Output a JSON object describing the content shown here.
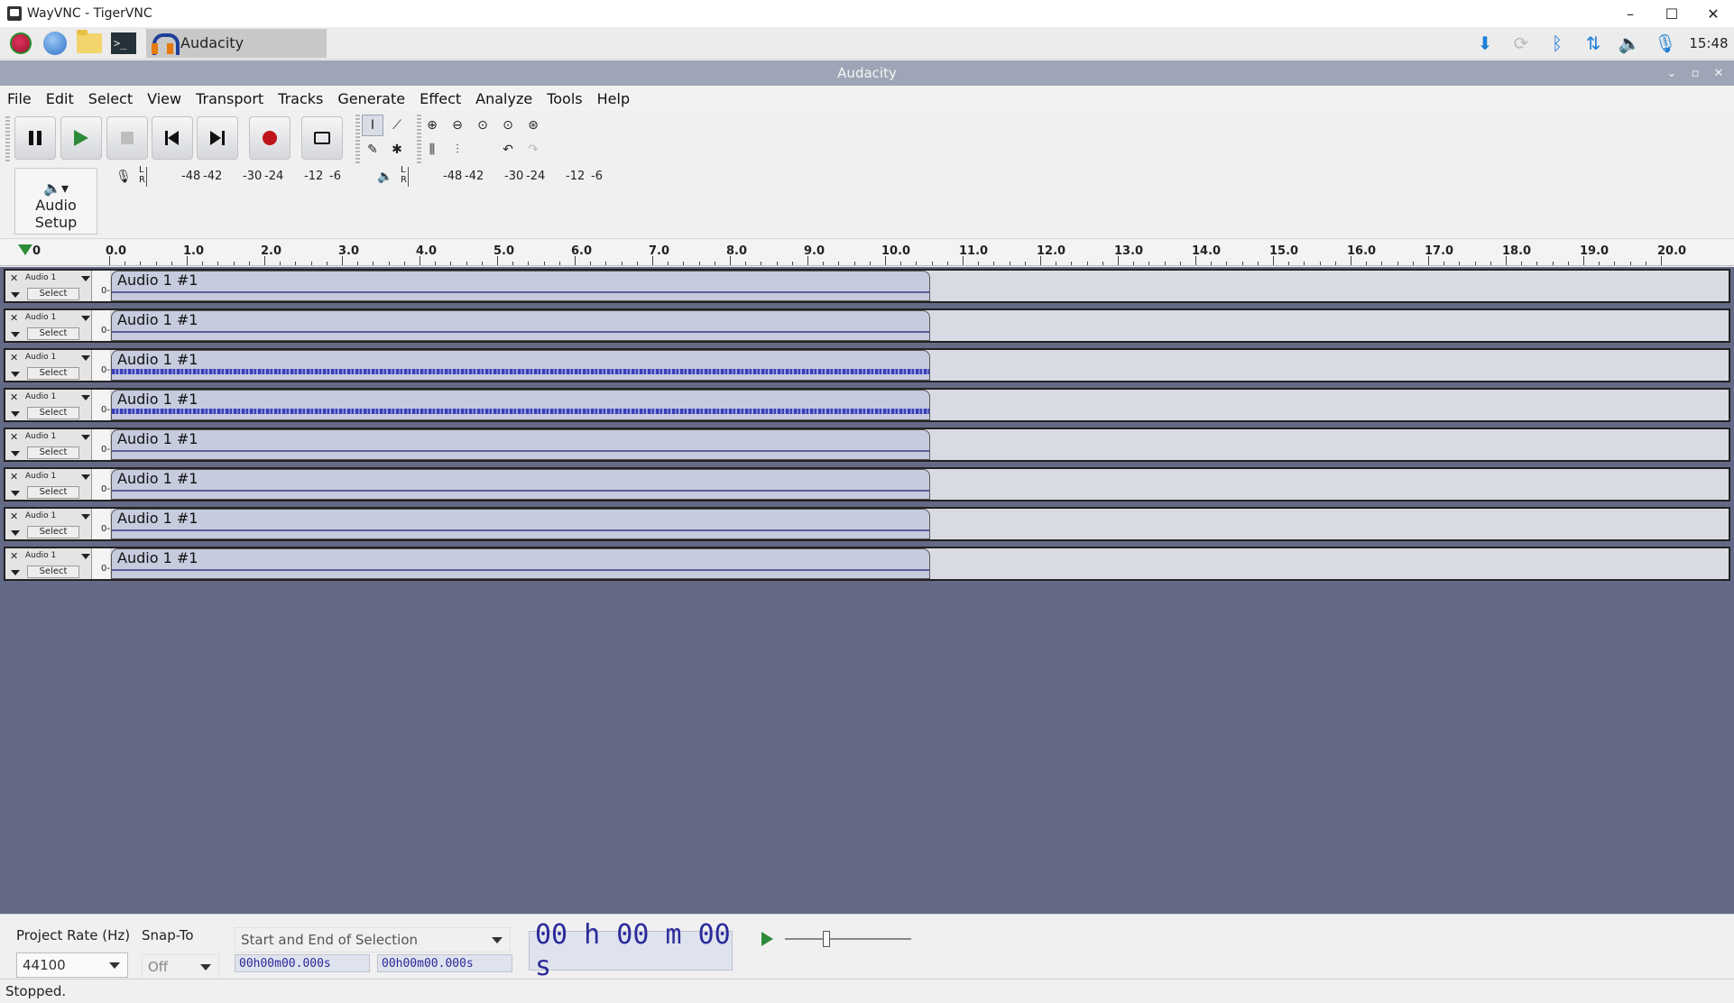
{
  "vnc_window": {
    "title": "WayVNC - TigerVNC",
    "controls": [
      "–",
      "☐",
      "✕"
    ]
  },
  "taskbar": {
    "active_task": "Audacity",
    "clock": "15:48"
  },
  "app": {
    "title": "Audacity"
  },
  "menu": [
    "File",
    "Edit",
    "Select",
    "View",
    "Transport",
    "Tracks",
    "Generate",
    "Effect",
    "Analyze",
    "Tools",
    "Help"
  ],
  "toolbar": {
    "audio_setup_label": "Audio Setup"
  },
  "meters": {
    "record": {
      "lr": "L\nR",
      "ticks": [
        "-48",
        "-42",
        "-30",
        "-24",
        "-12",
        "-6"
      ]
    },
    "playback": {
      "lr": "L\nR",
      "ticks": [
        "-48",
        "-42",
        "-30",
        "-24",
        "-12",
        "-6"
      ]
    }
  },
  "ruler": {
    "labels": [
      "0",
      "0.0",
      "1.0",
      "2.0",
      "3.0",
      "4.0",
      "5.0",
      "6.0",
      "7.0",
      "8.0",
      "9.0",
      "10.0",
      "11.0",
      "12.0",
      "13.0",
      "14.0",
      "15.0",
      "16.0",
      "17.0",
      "18.0",
      "19.0",
      "20.0"
    ]
  },
  "tracks": [
    {
      "name": "Audio 1",
      "clip": "Audio 1 #1",
      "select": "Select",
      "scale": "0-",
      "loud": false
    },
    {
      "name": "Audio 1",
      "clip": "Audio 1 #1",
      "select": "Select",
      "scale": "0-",
      "loud": false
    },
    {
      "name": "Audio 1",
      "clip": "Audio 1 #1",
      "select": "Select",
      "scale": "0-",
      "loud": true
    },
    {
      "name": "Audio 1",
      "clip": "Audio 1 #1",
      "select": "Select",
      "scale": "0-",
      "loud": true
    },
    {
      "name": "Audio 1",
      "clip": "Audio 1 #1",
      "select": "Select",
      "scale": "0-",
      "loud": false
    },
    {
      "name": "Audio 1",
      "clip": "Audio 1 #1",
      "select": "Select",
      "scale": "0-",
      "loud": false
    },
    {
      "name": "Audio 1",
      "clip": "Audio 1 #1",
      "select": "Select",
      "scale": "0-",
      "loud": false
    },
    {
      "name": "Audio 1",
      "clip": "Audio 1 #1",
      "select": "Select",
      "scale": "0-",
      "loud": false
    }
  ],
  "bottom": {
    "project_rate_label": "Project Rate (Hz)",
    "project_rate_value": "44100",
    "snap_to_label": "Snap-To",
    "snap_to_value": "Off",
    "selection_mode": "Start and End of Selection",
    "sel_start": "00h00m00.000s",
    "sel_end": "00h00m00.000s",
    "time_display": "00 h 00 m 00 s"
  },
  "status": "Stopped."
}
